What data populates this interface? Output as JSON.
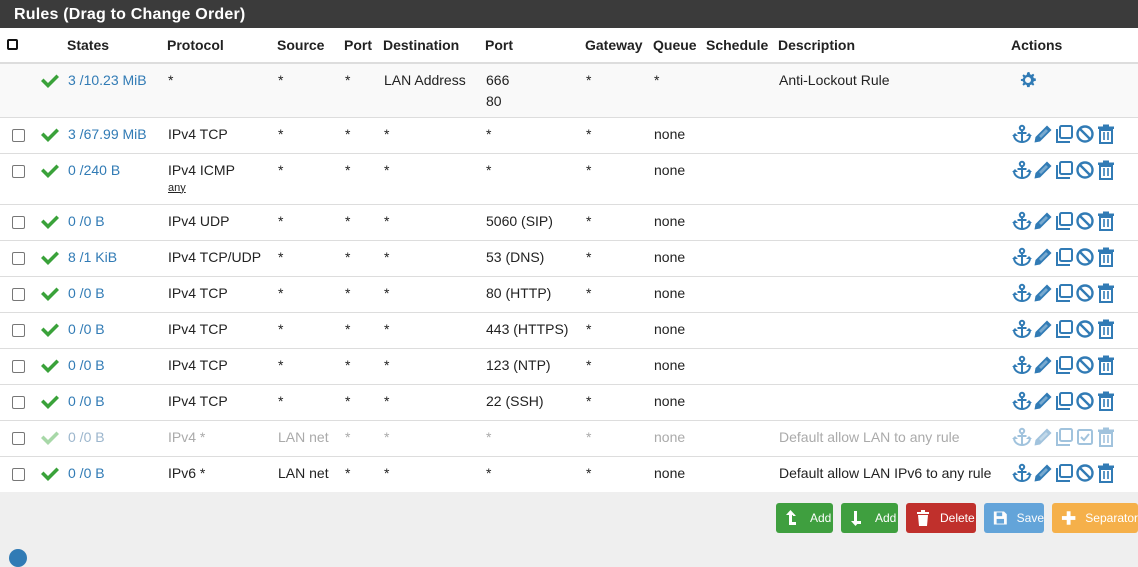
{
  "panel": {
    "title": "Rules (Drag to Change Order)"
  },
  "columns": {
    "states": "States",
    "protocol": "Protocol",
    "source": "Source",
    "sport": "Port",
    "destination": "Destination",
    "dport": "Port",
    "gateway": "Gateway",
    "queue": "Queue",
    "schedule": "Schedule",
    "description": "Description",
    "actions": "Actions"
  },
  "anti_lockout": {
    "states": "3 /10.23 MiB",
    "protocol": "*",
    "source": "*",
    "sport": "*",
    "destination": "LAN Address",
    "dport_1": "666",
    "dport_2": "80",
    "gateway": "*",
    "queue": "*",
    "description": "Anti-Lockout Rule"
  },
  "rules": [
    {
      "states": "3 /67.99 MiB",
      "protocol": "IPv4 TCP",
      "sub": "",
      "source": "*",
      "sport": "*",
      "destination": "*",
      "dport": "*",
      "gateway": "*",
      "queue": "none",
      "description": ""
    },
    {
      "states": "0 /240 B",
      "protocol": "IPv4 ICMP",
      "sub": "any",
      "source": "*",
      "sport": "*",
      "destination": "*",
      "dport": "*",
      "gateway": "*",
      "queue": "none",
      "description": ""
    },
    {
      "states": "0 /0 B",
      "protocol": "IPv4 UDP",
      "sub": "",
      "source": "*",
      "sport": "*",
      "destination": "*",
      "dport": "5060 (SIP)",
      "gateway": "*",
      "queue": "none",
      "description": ""
    },
    {
      "states": "8 /1 KiB",
      "protocol": "IPv4 TCP/UDP",
      "sub": "",
      "source": "*",
      "sport": "*",
      "destination": "*",
      "dport": "53 (DNS)",
      "gateway": "*",
      "queue": "none",
      "description": ""
    },
    {
      "states": "0 /0 B",
      "protocol": "IPv4 TCP",
      "sub": "",
      "source": "*",
      "sport": "*",
      "destination": "*",
      "dport": "80 (HTTP)",
      "gateway": "*",
      "queue": "none",
      "description": ""
    },
    {
      "states": "0 /0 B",
      "protocol": "IPv4 TCP",
      "sub": "",
      "source": "*",
      "sport": "*",
      "destination": "*",
      "dport": "443 (HTTPS)",
      "gateway": "*",
      "queue": "none",
      "description": ""
    },
    {
      "states": "0 /0 B",
      "protocol": "IPv4 TCP",
      "sub": "",
      "source": "*",
      "sport": "*",
      "destination": "*",
      "dport": "123 (NTP)",
      "gateway": "*",
      "queue": "none",
      "description": ""
    },
    {
      "states": "0 /0 B",
      "protocol": "IPv4 TCP",
      "sub": "",
      "source": "*",
      "sport": "*",
      "destination": "*",
      "dport": "22 (SSH)",
      "gateway": "*",
      "queue": "none",
      "description": ""
    },
    {
      "states": "0 /0 B",
      "protocol": "IPv4 *",
      "sub": "",
      "source": "LAN net",
      "sport": "*",
      "destination": "*",
      "dport": "*",
      "gateway": "*",
      "queue": "none",
      "description": "Default allow LAN to any rule",
      "disabled": true
    },
    {
      "states": "0 /0 B",
      "protocol": "IPv6 *",
      "sub": "",
      "source": "LAN net",
      "sport": "*",
      "destination": "*",
      "dport": "*",
      "gateway": "*",
      "queue": "none",
      "description": "Default allow LAN IPv6 to any rule"
    }
  ],
  "buttons": {
    "add_top": "Add",
    "add_bottom": "Add",
    "delete": "Delete",
    "save": "Save",
    "separator": "Separator"
  },
  "colors": {
    "header_bg": "#3b3b3b",
    "link": "#317bb5",
    "check": "#3aa23a",
    "action_icon": "#317bb5"
  }
}
